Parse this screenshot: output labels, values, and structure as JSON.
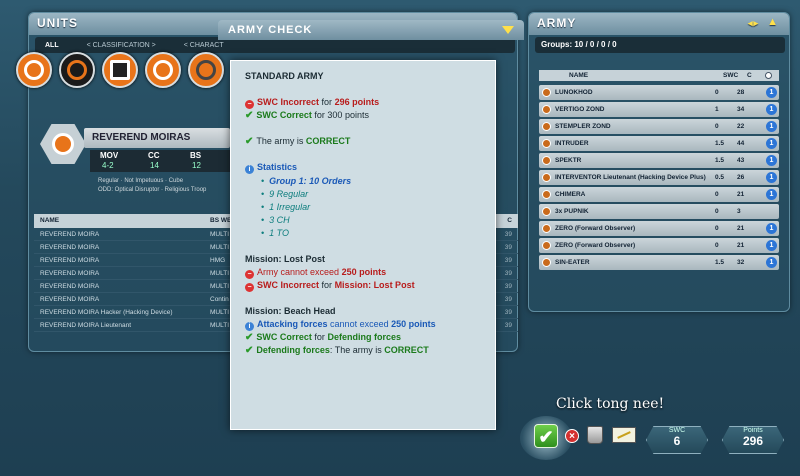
{
  "units": {
    "title": "UNITS",
    "tabs": [
      "ALL",
      "< CLASSIFICATION >",
      "< CHARACT"
    ],
    "unit": {
      "name": "REVEREND MOIRAS",
      "stats": [
        {
          "label": "MOV",
          "value": "4-2"
        },
        {
          "label": "CC",
          "value": "14"
        },
        {
          "label": "BS",
          "value": "12"
        }
      ],
      "sub1": "Regular · Not Impetuous · Cube",
      "sub2": "ODD: Optical Disruptor · Religious Troop"
    },
    "table": {
      "headers": {
        "name": "NAME",
        "weapons": "BS WE",
        "c": "C"
      },
      "rows": [
        {
          "name": "REVEREND MOIRA",
          "weapons": "MULTI",
          "c": "39"
        },
        {
          "name": "REVEREND MOIRA",
          "weapons": "MULTI",
          "c": "39"
        },
        {
          "name": "REVEREND MOIRA",
          "weapons": "HMG",
          "c": "39"
        },
        {
          "name": "REVEREND MOIRA",
          "weapons": "MULTI",
          "c": "39"
        },
        {
          "name": "REVEREND MOIRA",
          "weapons": "MULTI",
          "c": "39"
        },
        {
          "name": "REVEREND MOIRA",
          "weapons": "Contin",
          "c": "39"
        },
        {
          "name": "REVEREND MOIRA Hacker (Hacking Device)",
          "weapons": "MULTI",
          "c": "39"
        },
        {
          "name": "REVEREND MOIRA Lieutenant",
          "weapons": "MULTI",
          "c": "39"
        }
      ]
    }
  },
  "army_check": {
    "title": "ARMY CHECK",
    "heading": "STANDARD ARMY",
    "swc_incorrect_a": "SWC Incorrect",
    "swc_incorrect_b": "for",
    "swc_incorrect_c": "296 points",
    "swc_correct_a": "SWC Correct",
    "swc_correct_b": "for 300 points",
    "army_correct_a": "The army is",
    "army_correct_b": "CORRECT",
    "statistics": "Statistics",
    "stat_lines": [
      "Group 1:  10 Orders",
      "9 Regular",
      "1 Irregular",
      "3 CH",
      "1 TO"
    ],
    "mission1": "Mission: Lost Post",
    "m1_a1": "Army cannot exceed",
    "m1_a2": "250 points",
    "m1_b1": "SWC Incorrect",
    "m1_b2": "for",
    "m1_b3": "Mission: Lost Post",
    "mission2": "Mission: Beach Head",
    "m2_a1": "Attacking forces",
    "m2_a2": "cannot exceed",
    "m2_a3": "250 points",
    "m2_b1": "SWC Correct",
    "m2_b2": "for",
    "m2_b3": "Defending forces",
    "m2_c1": "Defending forces",
    "m2_c2": ": The army is",
    "m2_c3": "CORRECT"
  },
  "army": {
    "title": "ARMY",
    "groups": "Groups:  10 / 0 / 0 / 0",
    "headers": {
      "name": "NAME",
      "swc": "SWC",
      "c": "C"
    },
    "rows": [
      {
        "name": "LUNOKHOD",
        "swc": "0",
        "c": "28",
        "n": "1"
      },
      {
        "name": "VERTIGO ZOND",
        "swc": "1",
        "c": "34",
        "n": "1"
      },
      {
        "name": "STEMPLER ZOND",
        "swc": "0",
        "c": "22",
        "n": "1"
      },
      {
        "name": "INTRUDER",
        "swc": "1.5",
        "c": "44",
        "n": "1"
      },
      {
        "name": "SPEKTR",
        "swc": "1.5",
        "c": "43",
        "n": "1"
      },
      {
        "name": "INTERVENTOR Lieutenant (Hacking Device Plus)",
        "swc": "0.5",
        "c": "26",
        "n": "1"
      },
      {
        "name": "CHIMERA",
        "swc": "0",
        "c": "21",
        "n": "1"
      },
      {
        "name": "3x PUPNIK",
        "swc": "0",
        "c": "3",
        "n": ""
      },
      {
        "name": "ZERO (Forward Observer)",
        "swc": "0",
        "c": "21",
        "n": "1"
      },
      {
        "name": "ZERO (Forward Observer)",
        "swc": "0",
        "c": "21",
        "n": "1"
      },
      {
        "name": "SIN-EATER",
        "swc": "1.5",
        "c": "32",
        "n": "1"
      }
    ]
  },
  "footer": {
    "tooltip": "Click tong nee!",
    "swc_label": "SWC",
    "swc_value": "6",
    "points_label": "Points",
    "points_value": "296"
  },
  "colors": {
    "faction1": "#e8741a",
    "faction2": "#1a1a1a",
    "accent_ok": "#2a9a2a",
    "accent_err": "#d33"
  }
}
